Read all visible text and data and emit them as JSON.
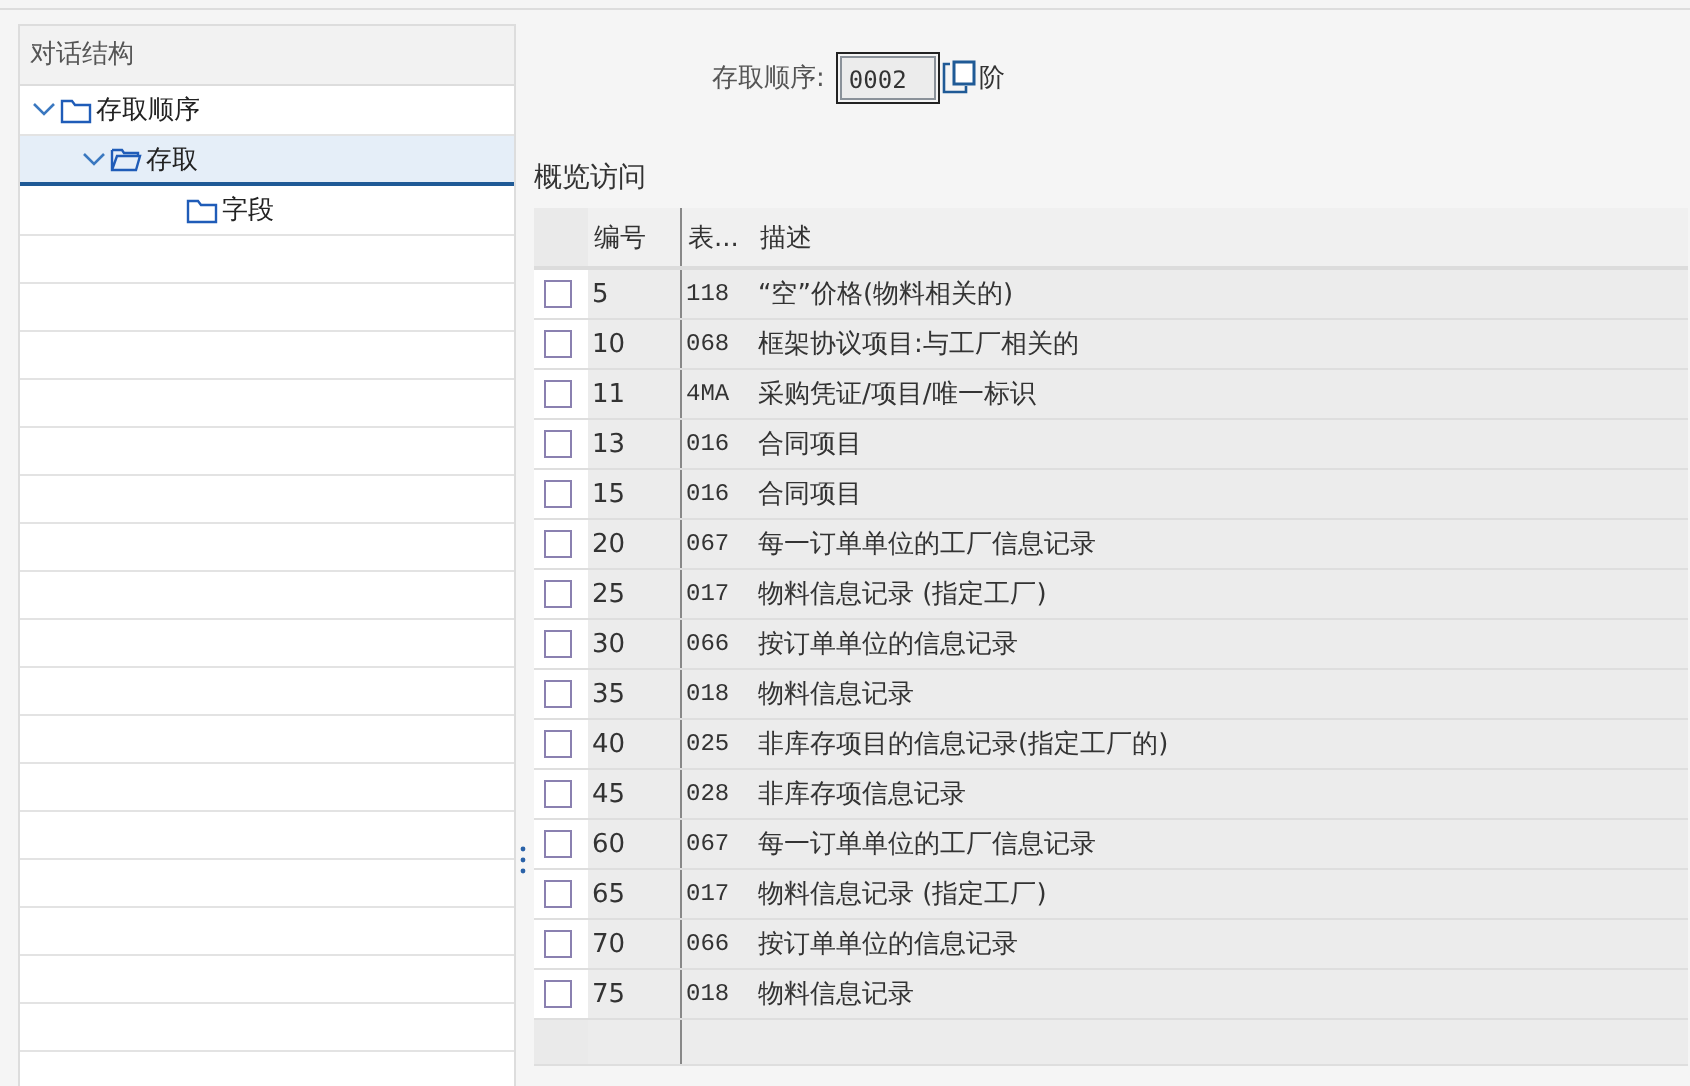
{
  "dialog_structure": {
    "title": "对话结构",
    "tree": [
      {
        "label": "存取顺序",
        "expanded": true,
        "selected": false,
        "children": [
          {
            "label": "存取",
            "expanded": true,
            "selected": true,
            "children": [
              {
                "label": "字段",
                "selected": false
              }
            ]
          }
        ]
      }
    ]
  },
  "access_sequence": {
    "label": "存取顺序:",
    "value": "0002",
    "suffix": "阶"
  },
  "overview": {
    "title": "概览访问",
    "columns": [
      "编号",
      "表...",
      "描述"
    ],
    "rows": [
      {
        "no": "5",
        "table": "118",
        "description": "“空”价格(物料相关的)",
        "checked": false
      },
      {
        "no": "10",
        "table": "068",
        "description": "框架协议项目:与工厂相关的",
        "checked": false
      },
      {
        "no": "11",
        "table": "4MA",
        "description": "采购凭证/项目/唯一标识",
        "checked": false
      },
      {
        "no": "13",
        "table": "016",
        "description": "合同项目",
        "checked": false
      },
      {
        "no": "15",
        "table": "016",
        "description": "合同项目",
        "checked": false
      },
      {
        "no": "20",
        "table": "067",
        "description": "每一订单单位的工厂信息记录",
        "checked": false
      },
      {
        "no": "25",
        "table": "017",
        "description": "物料信息记录 (指定工厂)",
        "checked": false
      },
      {
        "no": "30",
        "table": "066",
        "description": "按订单单位的信息记录",
        "checked": false
      },
      {
        "no": "35",
        "table": "018",
        "description": "物料信息记录",
        "checked": false
      },
      {
        "no": "40",
        "table": "025",
        "description": "非库存项目的信息记录(指定工厂的)",
        "checked": false
      },
      {
        "no": "45",
        "table": "028",
        "description": "非库存项信息记录",
        "checked": false
      },
      {
        "no": "60",
        "table": "067",
        "description": "每一订单单位的工厂信息记录",
        "checked": false
      },
      {
        "no": "65",
        "table": "017",
        "description": "物料信息记录 (指定工厂)",
        "checked": false
      },
      {
        "no": "70",
        "table": "066",
        "description": "按订单单位的信息记录",
        "checked": false
      },
      {
        "no": "75",
        "table": "018",
        "description": "物料信息记录",
        "checked": false
      }
    ]
  }
}
